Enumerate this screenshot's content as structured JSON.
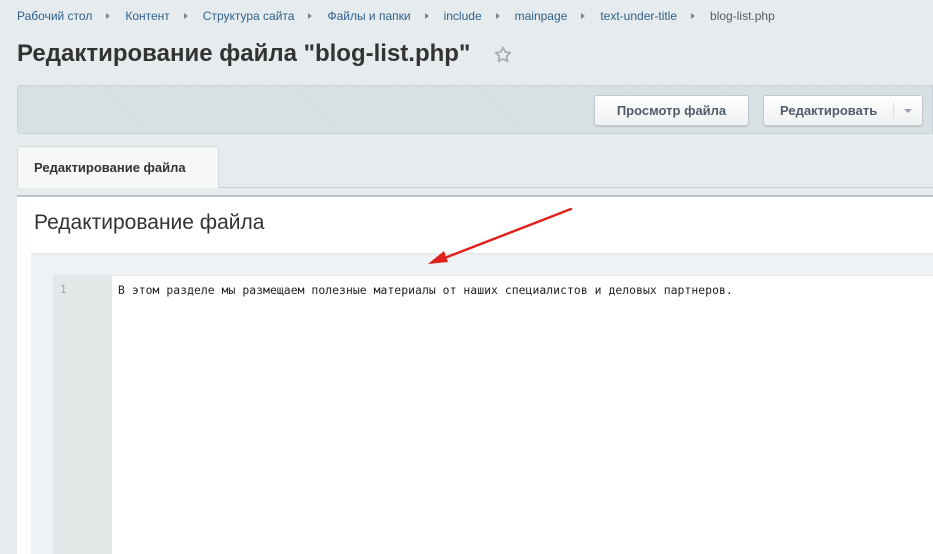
{
  "breadcrumb": {
    "items": [
      "Рабочий стол",
      "Контент",
      "Структура сайта",
      "Файлы и папки",
      "include",
      "mainpage",
      "text-under-title",
      "blog-list.php"
    ]
  },
  "header": {
    "title": "Редактирование файла \"blog-list.php\"",
    "favorite_icon": "star-icon"
  },
  "toolbar": {
    "view_label": "Просмотр файла",
    "edit_label": "Редактировать",
    "edit_dropdown_icon": "chevron-down-icon"
  },
  "tabs": [
    {
      "label": "Редактирование файла",
      "active": true
    }
  ],
  "main": {
    "section_title": "Редактирование файла",
    "editor": {
      "lines": [
        {
          "number": "1",
          "text": "В этом разделе мы размещаем полезные материалы от наших специалистов и деловых партнеров."
        }
      ]
    }
  },
  "annotation": {
    "arrow_color": "#e0201b",
    "icon": "arrow-icon"
  },
  "colors": {
    "link": "#2f5f8a",
    "background": "#e6ecee",
    "toolbar": "#d6dfe2"
  }
}
